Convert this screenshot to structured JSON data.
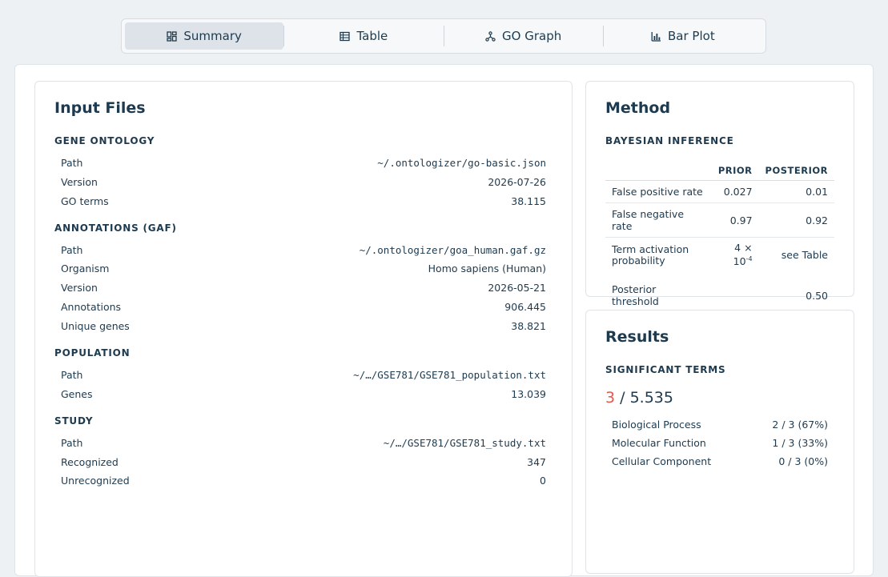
{
  "tabs": [
    {
      "label": "Summary",
      "icon": "summary-icon",
      "active": true
    },
    {
      "label": "Table",
      "icon": "table-icon",
      "active": false
    },
    {
      "label": "GO Graph",
      "icon": "graph-icon",
      "active": false
    },
    {
      "label": "Bar Plot",
      "icon": "bar-chart-icon",
      "active": false
    }
  ],
  "input_files": {
    "title": "Input Files",
    "gene_ontology": {
      "heading": "GENE ONTOLOGY",
      "rows": [
        {
          "label": "Path",
          "value": "~/.ontologizer/go-basic.json"
        },
        {
          "label": "Version",
          "value": "2026-07-26"
        },
        {
          "label": "GO terms",
          "value": "38.115"
        }
      ]
    },
    "annotations": {
      "heading": "ANNOTATIONS (GAF)",
      "rows": [
        {
          "label": "Path",
          "value": "~/.ontologizer/goa_human.gaf.gz"
        },
        {
          "label": "Organism",
          "value": "Homo sapiens (Human)"
        },
        {
          "label": "Version",
          "value": "2026-05-21"
        },
        {
          "label": "Annotations",
          "value": "906.445"
        },
        {
          "label": "Unique genes",
          "value": "38.821"
        }
      ]
    },
    "population": {
      "heading": "POPULATION",
      "rows": [
        {
          "label": "Path",
          "value": "~/…/GSE781/GSE781_population.txt"
        },
        {
          "label": "Genes",
          "value": "13.039"
        }
      ]
    },
    "study": {
      "heading": "STUDY",
      "rows": [
        {
          "label": "Path",
          "value": "~/…/GSE781/GSE781_study.txt"
        },
        {
          "label": "Recognized",
          "value": "347"
        },
        {
          "label": "Unrecognized",
          "value": "0"
        }
      ]
    }
  },
  "method": {
    "title": "Method",
    "heading": "BAYESIAN INFERENCE",
    "col_prior": "PRIOR",
    "col_posterior": "POSTERIOR",
    "rows": [
      {
        "label": "False positive rate",
        "prior": "0.027",
        "posterior": "0.01"
      },
      {
        "label": "False negative rate",
        "prior": "0.97",
        "posterior": "0.92"
      },
      {
        "label": "Term activation probability",
        "prior_base": "4 ×",
        "prior_pow": "10",
        "prior_exp": "-4",
        "posterior": "see Table"
      },
      {
        "label": "Posterior threshold",
        "prior": "",
        "posterior": "0.50"
      }
    ]
  },
  "results": {
    "title": "Results",
    "heading": "SIGNIFICANT TERMS",
    "significant": "3",
    "total": "/ 5.535",
    "accent_color": "#e05a4f",
    "rows": [
      {
        "label": "Biological Process",
        "value": "2 / 3 (67%)"
      },
      {
        "label": "Molecular Function",
        "value": "1 / 3 (33%)"
      },
      {
        "label": "Cellular Component",
        "value": "0 / 3 (0%)"
      }
    ]
  }
}
